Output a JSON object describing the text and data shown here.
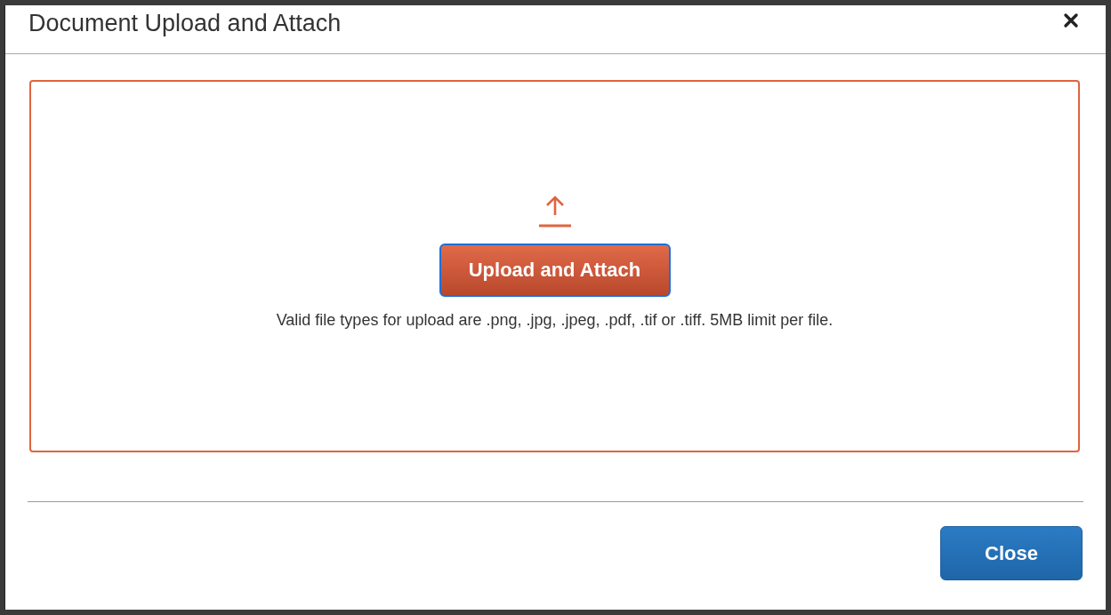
{
  "dialog": {
    "title": "Document Upload and Attach"
  },
  "drop_zone": {
    "upload_button": {
      "label": "Upload and Attach",
      "focused": true
    },
    "hint": "Valid file types for upload are .png, .jpg, .jpeg, .pdf, .tif or .tiff. 5MB limit per file."
  },
  "footer": {
    "close_button": {
      "label": "Close"
    }
  }
}
